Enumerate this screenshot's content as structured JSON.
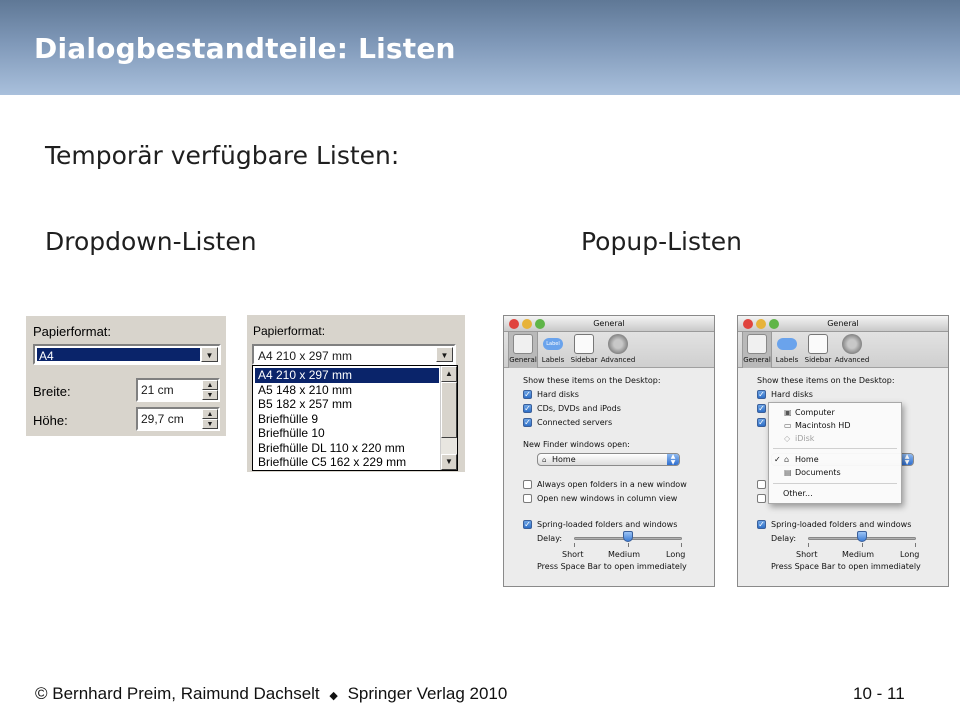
{
  "slide": {
    "title": "Dialogbestandteile: Listen",
    "intro": "Temporär verfügbare Listen:",
    "col_left": "Dropdown-Listen",
    "col_right": "Popup-Listen"
  },
  "win_dialog_a": {
    "paper_label": "Papierformat:",
    "paper_value": "A4",
    "width_label": "Breite:",
    "width_value": "21 cm",
    "height_label": "Höhe:",
    "height_value": "29,7 cm"
  },
  "win_dialog_b": {
    "paper_label": "Papierformat:",
    "paper_value": "A4 210 x 297 mm",
    "options": [
      "A4 210 x 297 mm",
      "A5 148 x 210 mm",
      "B5 182 x 257 mm",
      "Briefhülle 9",
      "Briefhülle 10",
      "Briefhülle DL 110 x 220 mm",
      "Briefhülle C5 162 x 229 mm"
    ],
    "selected_index": 0
  },
  "mac_prefs": {
    "window_title": "General",
    "toolbar": [
      "General",
      "Labels",
      "Sidebar",
      "Advanced"
    ],
    "toolbar_label_badge": "Label",
    "desktop_heading": "Show these items on the Desktop:",
    "desktop_items": [
      "Hard disks",
      "CDs, DVDs and iPods",
      "Connected servers"
    ],
    "finder_heading": "New Finder windows open:",
    "finder_value": "Home",
    "option_always": "Always open folders in a new window",
    "option_column": "Open new windows in column view",
    "option_spring": "Spring-loaded folders and windows",
    "delay_label": "Delay:",
    "slider_labels": [
      "Short",
      "Medium",
      "Long"
    ],
    "slider_value": 0.5,
    "hint": "Press Space Bar to open immediately"
  },
  "mac_popup_menu": {
    "items_top": [
      "Computer",
      "Macintosh HD",
      "iDisk"
    ],
    "items_mid": [
      "Home",
      "Documents"
    ],
    "checked": "Home",
    "items_bottom": [
      "Other..."
    ],
    "disabled": [
      "iDisk"
    ]
  },
  "footer": {
    "left": "© Bernhard Preim, Raimund Dachselt",
    "separator": "◆",
    "right": "Springer Verlag 2010",
    "page": "10 - 11"
  },
  "colors": {
    "header_top": "#5f7896",
    "header_bottom": "#a9c0dc",
    "win_selection": "#0a246a",
    "mac_blue": "#2f6fd0"
  }
}
